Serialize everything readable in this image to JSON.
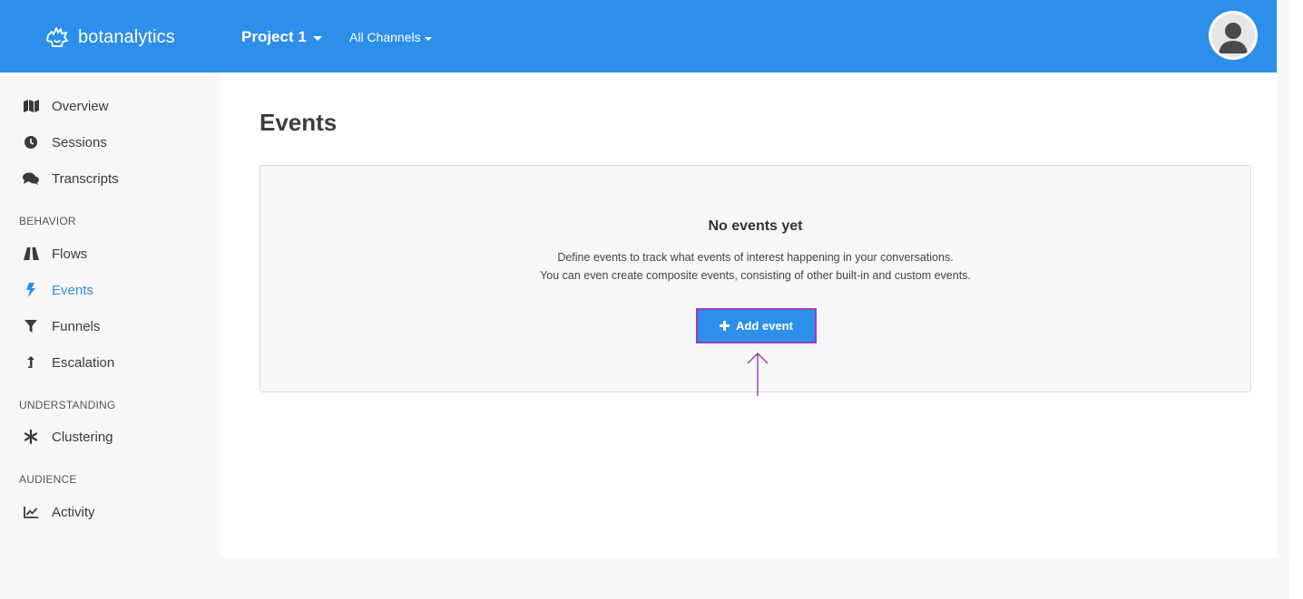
{
  "header": {
    "brand": "botanalytics",
    "project_label": "Project 1",
    "channels_label": "All Channels"
  },
  "sidebar": {
    "items_top": [
      {
        "label": "Overview",
        "icon": "map-icon"
      },
      {
        "label": "Sessions",
        "icon": "clock-icon"
      },
      {
        "label": "Transcripts",
        "icon": "chat-bubbles-icon"
      }
    ],
    "behavior_header": "BEHAVIOR",
    "items_behavior": [
      {
        "label": "Flows",
        "icon": "road-icon"
      },
      {
        "label": "Events",
        "icon": "bolt-icon",
        "active": true
      },
      {
        "label": "Funnels",
        "icon": "filter-icon"
      },
      {
        "label": "Escalation",
        "icon": "level-up-icon"
      }
    ],
    "understanding_header": "UNDERSTANDING",
    "items_understanding": [
      {
        "label": "Clustering",
        "icon": "asterisk-icon"
      }
    ],
    "audience_header": "AUDIENCE",
    "items_audience": [
      {
        "label": "Activity",
        "icon": "line-chart-icon"
      }
    ]
  },
  "main": {
    "title": "Events",
    "empty": {
      "title": "No events yet",
      "line1": "Define events to track what events of interest happening in your conversations.",
      "line2": "You can even create composite events, consisting of other built-in and custom events.",
      "button_label": "Add event"
    }
  },
  "colors": {
    "brand_blue": "#2d8fea",
    "highlight_purple": "#9a3fc0"
  }
}
